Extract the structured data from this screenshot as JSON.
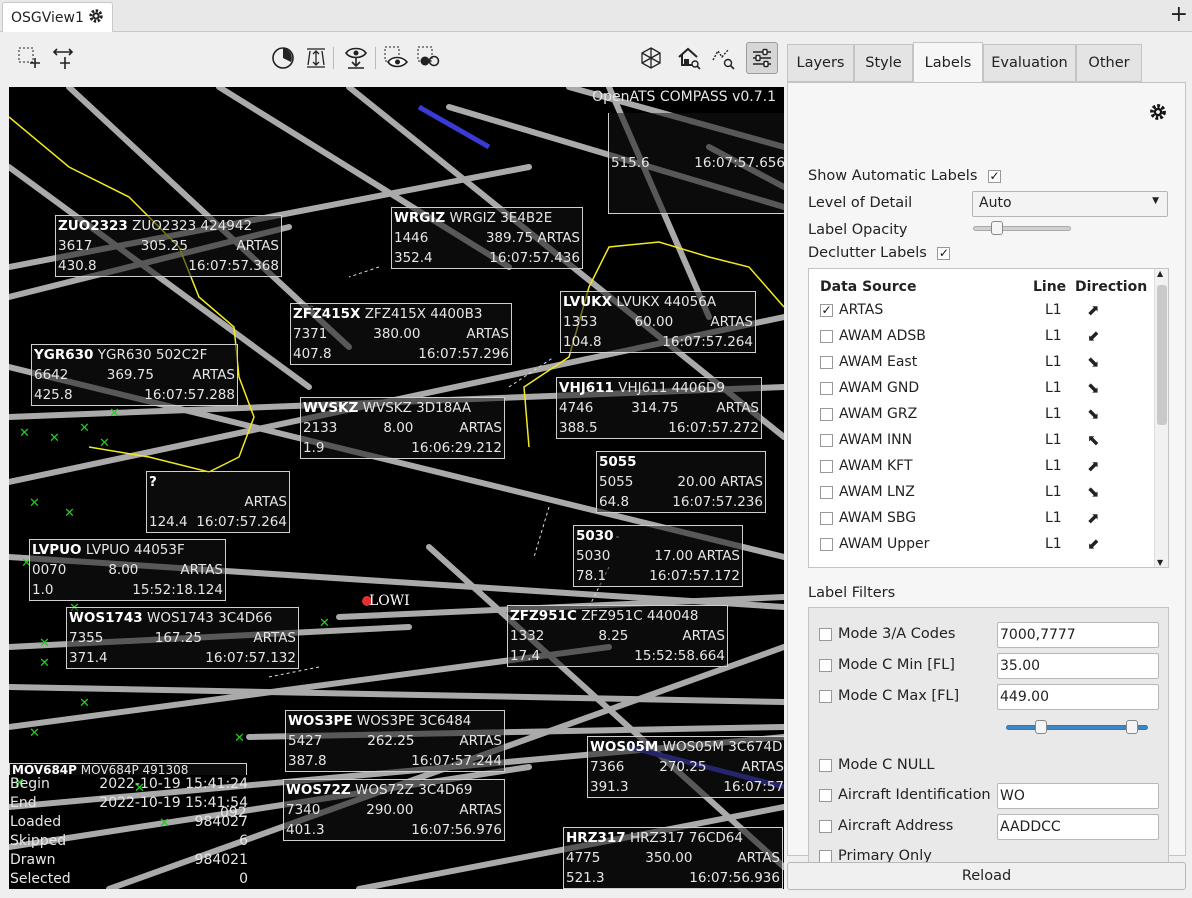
{
  "window_tab": {
    "title": "OSGView1",
    "icon": "gear-icon",
    "new_tab_icon": "plus-icon"
  },
  "toolbar": {
    "left": [
      "select-add-icon",
      "select-move-icon"
    ],
    "center": [
      "time-filter-icon",
      "height-filter-icon",
      "show-icon",
      "eye-select-icon",
      "eye-selected-icon"
    ],
    "right": [
      "3d-view-icon",
      "home-search-icon",
      "zoom-search-icon",
      "settings-sliders-icon"
    ]
  },
  "map": {
    "version": "OpenATS COMPASS v0.7.1",
    "airport": "LOWI",
    "colors": {
      "background": "#000000",
      "track": "#cfcfcf",
      "sector": "#f2ea20",
      "highlight": "#3a3ad6",
      "marker": "#22cc22"
    },
    "partial_top": {
      "l1": "515.6",
      "l2": "16:07:57.656"
    },
    "labels": [
      {
        "cs": "ZUO2323",
        "mode": "ZUO2323 424942",
        "a": "3617",
        "b": "305.25",
        "c": "ARTAS",
        "d": "430.8",
        "t": "16:07:57.368"
      },
      {
        "cs": "WRGIZ",
        "mode": "WRGIZ 3E4B2E",
        "a": "1446",
        "b": "389.75 ARTAS",
        "c": "",
        "d": "352.4",
        "t": "16:07:57.436"
      },
      {
        "cs": "ZFZ415X",
        "mode": "ZFZ415X 4400B3",
        "a": "7371",
        "b": "380.00",
        "c": "ARTAS",
        "d": "407.8",
        "t": "16:07:57.296"
      },
      {
        "cs": "LVUKX",
        "mode": "LVUKX 44056A",
        "a": "1353",
        "b": "60.00",
        "c": "ARTAS",
        "d": "104.8",
        "t": "16:07:57.264"
      },
      {
        "cs": "YGR630",
        "mode": "YGR630 502C2F",
        "a": "6642",
        "b": "369.75",
        "c": "ARTAS",
        "d": "425.8",
        "t": "16:07:57.288"
      },
      {
        "cs": "WVSKZ",
        "mode": "WVSKZ 3D18AA",
        "a": "2133",
        "b": "8.00",
        "c": "ARTAS",
        "d": "1.9",
        "t": "16:06:29.212"
      },
      {
        "cs": "VHJ611",
        "mode": "VHJ611 4406D9",
        "a": "4746",
        "b": "314.75",
        "c": "ARTAS",
        "d": "388.5",
        "t": "16:07:57.272"
      },
      {
        "cs": "?",
        "mode": "",
        "a": "",
        "b": "ARTAS",
        "c": "",
        "d": "124.4",
        "t": "16:07:57.264"
      },
      {
        "cs": "5055",
        "mode": "",
        "a": "5055",
        "b": "20.00 ARTAS",
        "c": "",
        "d": "64.8",
        "t": "16:07:57.236"
      },
      {
        "cs": "5030",
        "mode": "",
        "a": "5030",
        "b": "17.00 ARTAS",
        "c": "",
        "d": "78.1",
        "t": "16:07:57.172"
      },
      {
        "cs": "LVPUO",
        "mode": "LVPUO 44053F",
        "a": "0070",
        "b": "8.00",
        "c": "ARTAS",
        "d": "1.0",
        "t": "15:52:18.124"
      },
      {
        "cs": "WOS1743",
        "mode": "WOS1743 3C4D66",
        "a": "7355",
        "b": "167.25",
        "c": "ARTAS",
        "d": "371.4",
        "t": "16:07:57.132"
      },
      {
        "cs": "ZFZ951C",
        "mode": "ZFZ951C 440048",
        "a": "1332",
        "b": "8.25",
        "c": "ARTAS",
        "d": "17.4",
        "t": "15:52:58.664"
      },
      {
        "cs": "WOS3PE",
        "mode": "WOS3PE 3C6484",
        "a": "5427",
        "b": "262.25",
        "c": "ARTAS",
        "d": "387.8",
        "t": "16:07:57.244"
      },
      {
        "cs": "WOS05M",
        "mode": "WOS05M 3C674D",
        "a": "7366",
        "b": "270.25",
        "c": "ARTAS",
        "d": "391.3",
        "t": "16:07:57"
      },
      {
        "cs": "WOS72Z",
        "mode": "WOS72Z 3C4D69",
        "a": "7340",
        "b": "290.00",
        "c": "ARTAS",
        "d": "401.3",
        "t": "16:07:56.976"
      },
      {
        "cs": "HRZ317",
        "mode": "HRZ317 76CD64",
        "a": "4775",
        "b": "350.00",
        "c": "ARTAS",
        "d": "521.3",
        "t": "16:07:56.936"
      },
      {
        "cs": "MOV684P",
        "mode": "MOV684P 491308",
        "a": "",
        "b": "",
        "c": "",
        "d": "",
        "t": ""
      }
    ],
    "info": [
      {
        "k": "Begin",
        "v": "2022-10-19 15:41:24"
      },
      {
        "k": "End",
        "v": "2022-10-19 15:41:54"
      },
      {
        "k": "Loaded",
        "v": "984027"
      },
      {
        "k": "Skipped",
        "v": "6"
      },
      {
        "k": "Drawn",
        "v": "984021"
      },
      {
        "k": "Selected",
        "v": "0"
      }
    ],
    "info_fragment": "092"
  },
  "panel": {
    "tabs": [
      "Layers",
      "Style",
      "Labels",
      "Evaluation",
      "Other"
    ],
    "selected_tab": "Labels",
    "settings_icon": "gear-icon",
    "show_auto_labels": {
      "label": "Show Automatic Labels",
      "checked": true
    },
    "lod": {
      "label": "Level of Detail",
      "value": "Auto"
    },
    "opacity": {
      "label": "Label Opacity",
      "value": 0.2
    },
    "declutter": {
      "label": "Declutter Labels",
      "checked": true
    },
    "ds_headers": {
      "source": "Data Source",
      "line": "Line",
      "direction": "Direction"
    },
    "ds_rows": [
      {
        "name": "ARTAS",
        "checked": true,
        "line": "L1",
        "dir": "⬈"
      },
      {
        "name": "AWAM ADSB",
        "checked": false,
        "line": "L1",
        "dir": "⬋"
      },
      {
        "name": "AWAM East",
        "checked": false,
        "line": "L1",
        "dir": "⬊"
      },
      {
        "name": "AWAM GND",
        "checked": false,
        "line": "L1",
        "dir": "⬊"
      },
      {
        "name": "AWAM GRZ",
        "checked": false,
        "line": "L1",
        "dir": "⬊"
      },
      {
        "name": "AWAM INN",
        "checked": false,
        "line": "L1",
        "dir": "⬉"
      },
      {
        "name": "AWAM KFT",
        "checked": false,
        "line": "L1",
        "dir": "⬈"
      },
      {
        "name": "AWAM LNZ",
        "checked": false,
        "line": "L1",
        "dir": "⬊"
      },
      {
        "name": "AWAM SBG",
        "checked": false,
        "line": "L1",
        "dir": "⬈"
      },
      {
        "name": "AWAM Upper",
        "checked": false,
        "line": "L1",
        "dir": "⬋"
      }
    ],
    "filters_title": "Label Filters",
    "filters": [
      {
        "label": "Mode 3/A Codes",
        "checked": false,
        "value": "7000,7777"
      },
      {
        "label": "Mode C Min [FL]",
        "checked": false,
        "value": "35.00"
      },
      {
        "label": "Mode C Max [FL]",
        "checked": false,
        "value": "449.00"
      },
      {
        "label": "Mode C NULL",
        "checked": false,
        "value": null
      },
      {
        "label": "Aircraft Identification",
        "checked": false,
        "value": "WO"
      },
      {
        "label": "Aircraft Address",
        "checked": false,
        "value": "AADDCC"
      },
      {
        "label": "Primary Only",
        "checked": false,
        "value": null
      }
    ],
    "fl_range": {
      "min_fraction": 0.24,
      "max_fraction": 0.88
    }
  },
  "reload_label": "Reload"
}
